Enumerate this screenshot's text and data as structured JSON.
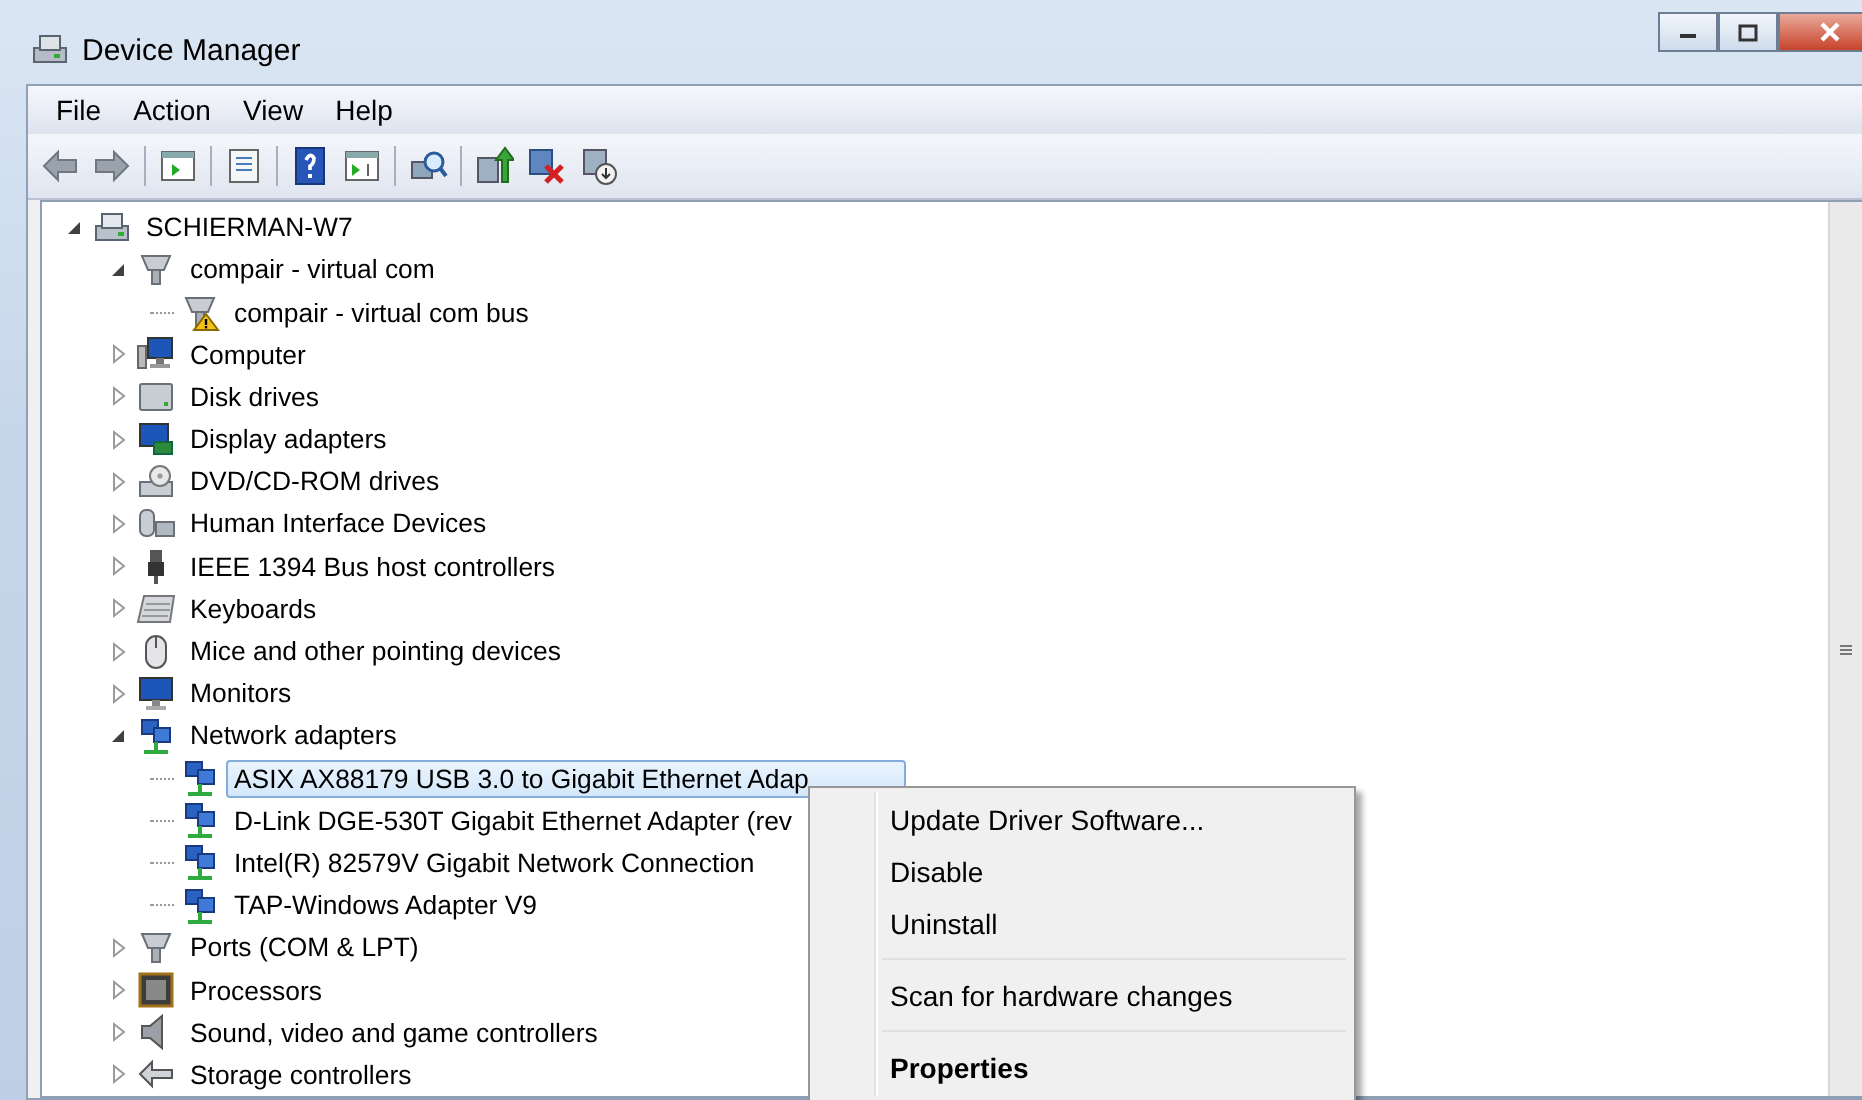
{
  "window": {
    "title": "Device Manager"
  },
  "menu_bar": [
    "File",
    "Action",
    "View",
    "Help"
  ],
  "tree": [
    {
      "label": "SCHIERMAN-W7",
      "kind": "computer-root",
      "expanded": true,
      "selected": false,
      "children": [
        {
          "label": "compair - virtual com",
          "kind": "port",
          "expanded": true,
          "selected": false,
          "children": [
            {
              "label": "compair - virtual com bus",
              "kind": "port",
              "warning": true,
              "selected": false
            }
          ]
        },
        {
          "label": "Computer",
          "kind": "computer",
          "expanded": false,
          "selected": false
        },
        {
          "label": "Disk drives",
          "kind": "disk",
          "expanded": false,
          "selected": false
        },
        {
          "label": "Display adapters",
          "kind": "display",
          "expanded": false,
          "selected": false
        },
        {
          "label": "DVD/CD-ROM drives",
          "kind": "dvd",
          "expanded": false,
          "selected": false
        },
        {
          "label": "Human Interface Devices",
          "kind": "hid",
          "expanded": false,
          "selected": false
        },
        {
          "label": "IEEE 1394 Bus host controllers",
          "kind": "plug",
          "expanded": false,
          "selected": false
        },
        {
          "label": "Keyboards",
          "kind": "keyboard",
          "expanded": false,
          "selected": false
        },
        {
          "label": "Mice and other pointing devices",
          "kind": "mouse",
          "expanded": false,
          "selected": false
        },
        {
          "label": "Monitors",
          "kind": "monitor",
          "expanded": false,
          "selected": false
        },
        {
          "label": "Network adapters",
          "kind": "network",
          "expanded": true,
          "selected": false,
          "children": [
            {
              "label": "ASIX AX88179 USB 3.0 to Gigabit Ethernet Adap",
              "kind": "network",
              "selected": true
            },
            {
              "label": "D-Link DGE-530T Gigabit Ethernet Adapter (rev",
              "kind": "network",
              "selected": false
            },
            {
              "label": "Intel(R) 82579V Gigabit Network Connection",
              "kind": "network",
              "selected": false
            },
            {
              "label": "TAP-Windows Adapter V9",
              "kind": "network",
              "selected": false
            }
          ]
        },
        {
          "label": "Ports (COM & LPT)",
          "kind": "port",
          "expanded": false,
          "selected": false
        },
        {
          "label": "Processors",
          "kind": "processor",
          "expanded": false,
          "selected": false
        },
        {
          "label": "Sound, video and game controllers",
          "kind": "sound",
          "expanded": false,
          "selected": false
        },
        {
          "label": "Storage controllers",
          "kind": "storage",
          "expanded": false,
          "selected": false
        }
      ]
    }
  ],
  "context_menu": [
    {
      "label": "Update Driver Software...",
      "separator_before": false,
      "default": false
    },
    {
      "label": "Disable",
      "separator_before": false,
      "default": false
    },
    {
      "label": "Uninstall",
      "separator_before": false,
      "default": false
    },
    {
      "label": "Scan for hardware changes",
      "separator_before": true,
      "default": false
    },
    {
      "label": "Properties",
      "separator_before": true,
      "default": true
    }
  ]
}
